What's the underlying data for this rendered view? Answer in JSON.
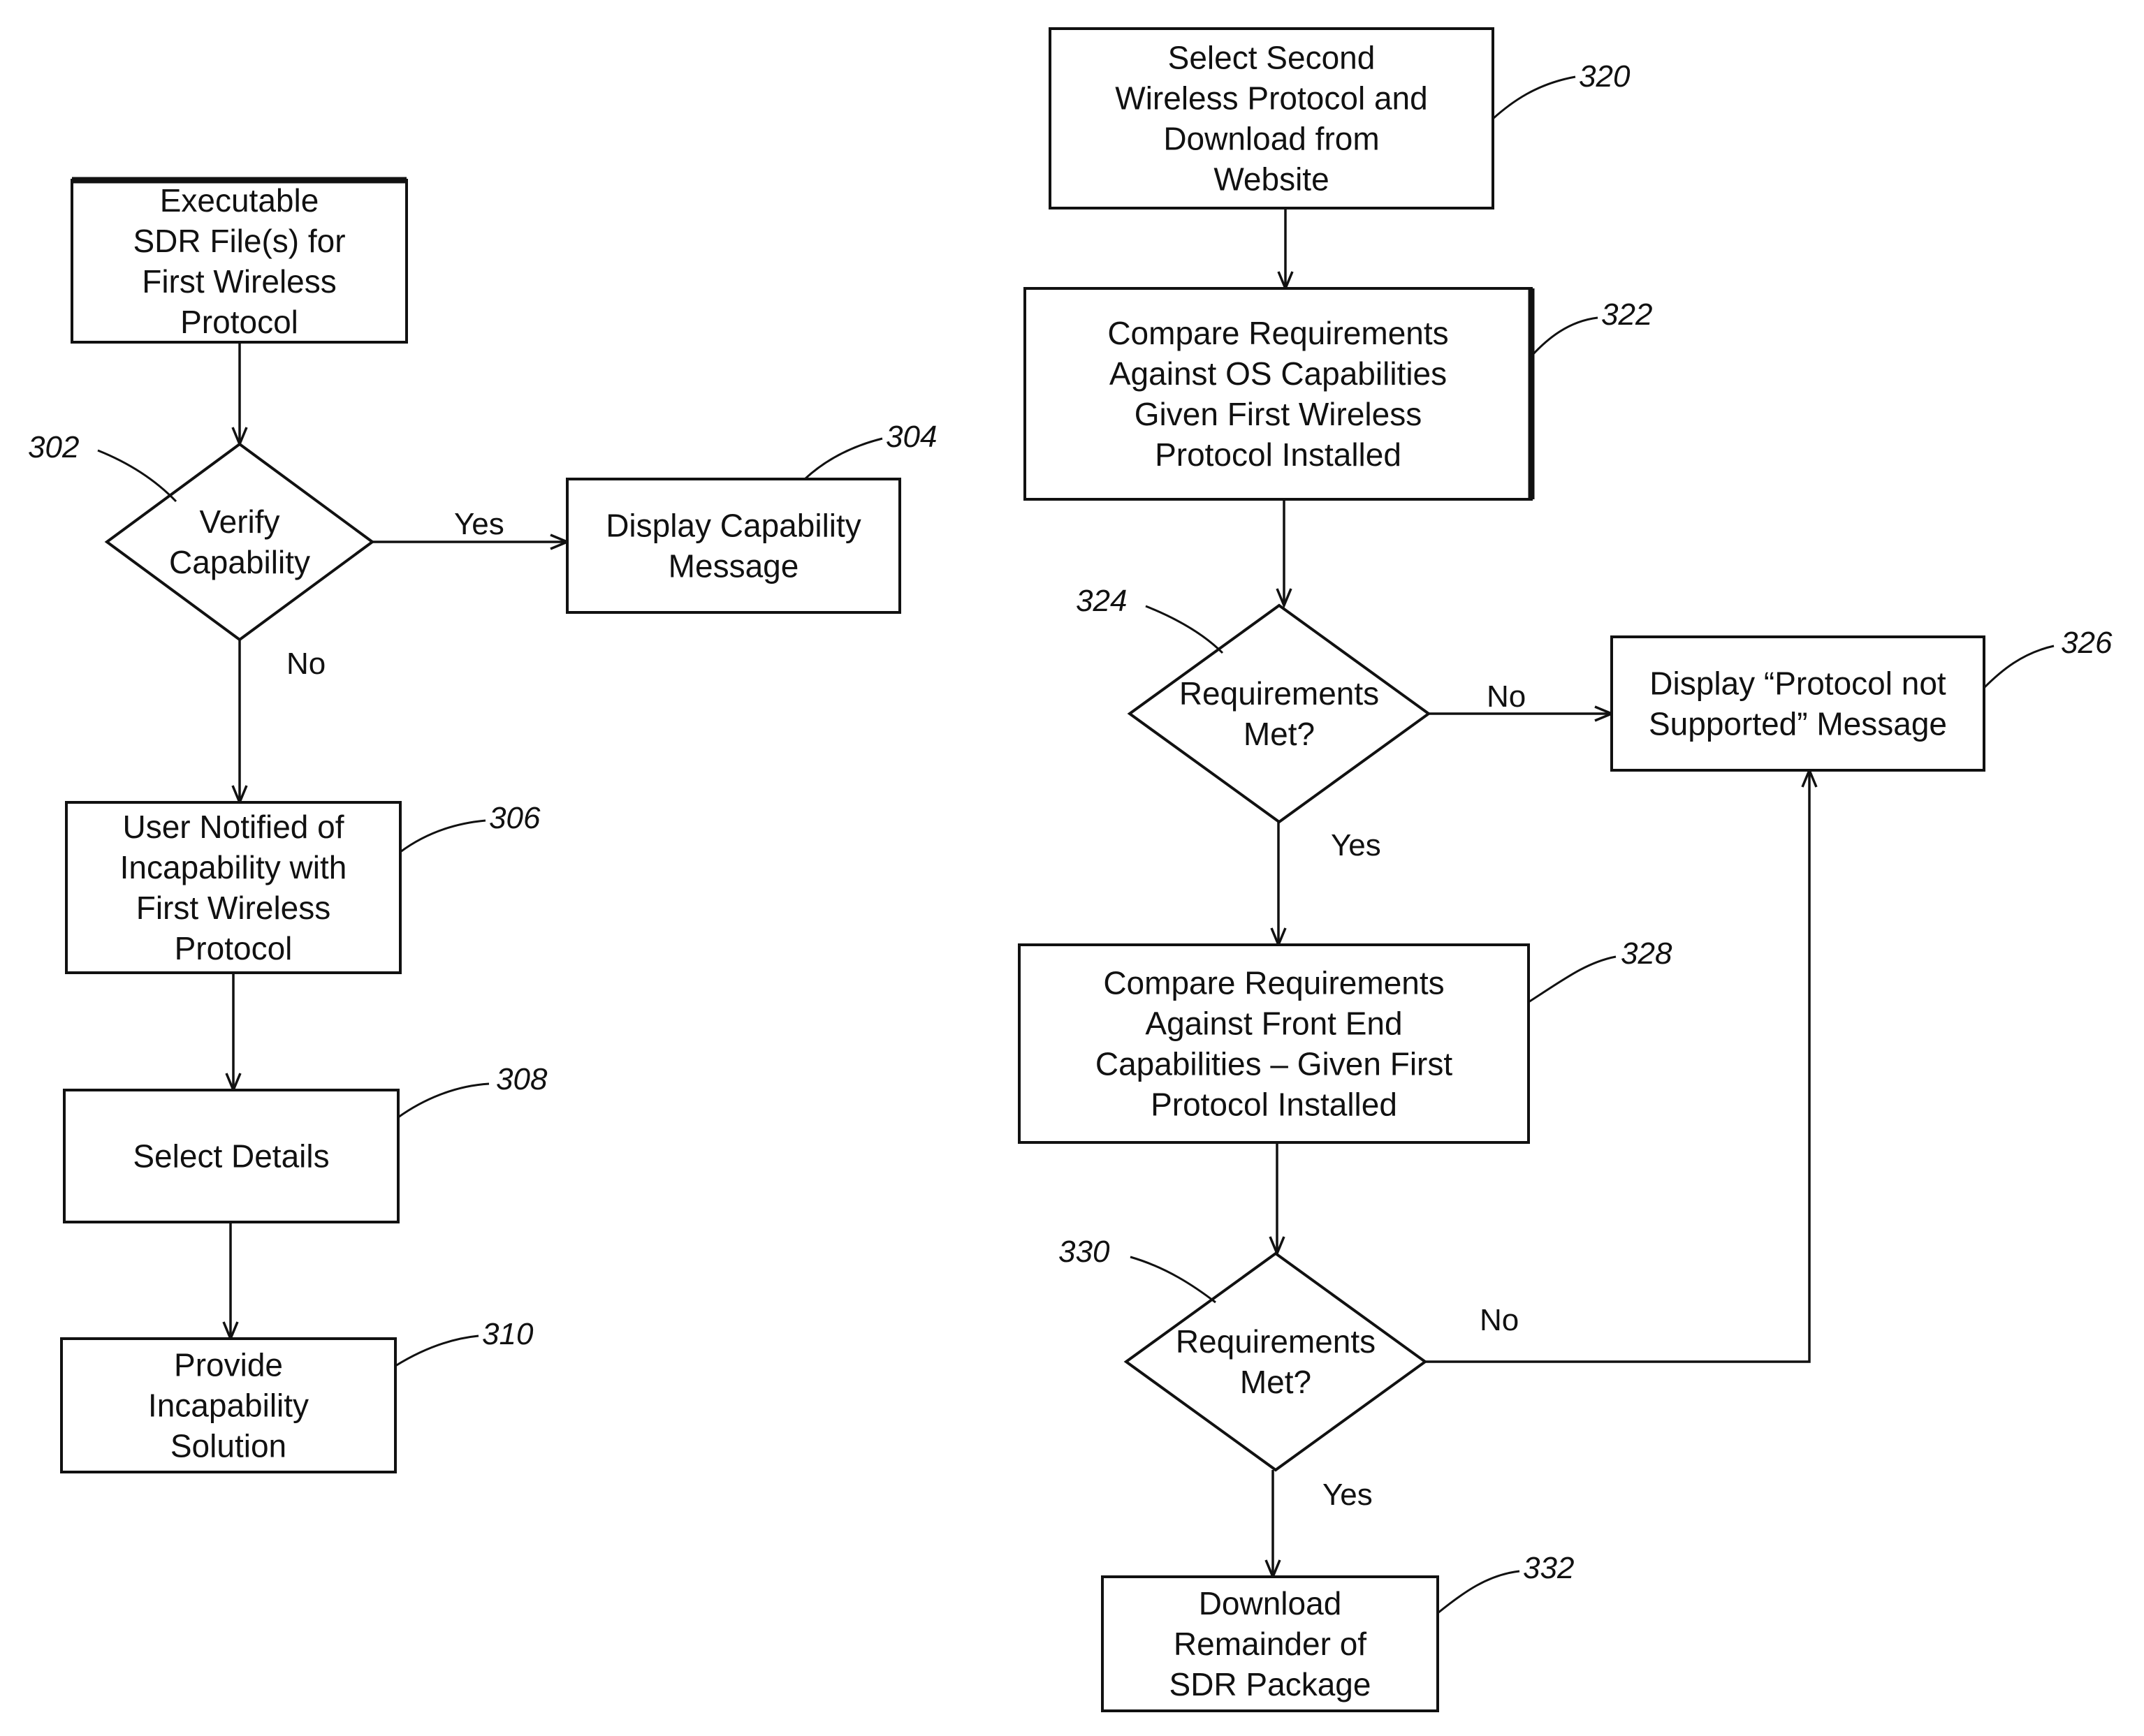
{
  "diagram": {
    "nodes": [
      {
        "id": "exec",
        "shape": "box",
        "lines": [
          "Executable",
          "SDR File(s) for",
          "First Wireless",
          "Protocol"
        ],
        "ref": ""
      },
      {
        "id": "302",
        "shape": "diamond",
        "lines": [
          "Verify",
          "Capability"
        ],
        "ref": "302"
      },
      {
        "id": "304",
        "shape": "box",
        "lines": [
          "Display Capability",
          "Message"
        ],
        "ref": "304"
      },
      {
        "id": "306",
        "shape": "box",
        "lines": [
          "User Notified of",
          "Incapability with",
          "First Wireless",
          "Protocol"
        ],
        "ref": "306"
      },
      {
        "id": "308",
        "shape": "box",
        "lines": [
          "Select Details"
        ],
        "ref": "308"
      },
      {
        "id": "310",
        "shape": "box",
        "lines": [
          "Provide",
          "Incapability",
          "Solution"
        ],
        "ref": "310"
      },
      {
        "id": "320",
        "shape": "box",
        "lines": [
          "Select Second",
          "Wireless Protocol and",
          "Download from",
          "Website"
        ],
        "ref": "320"
      },
      {
        "id": "322",
        "shape": "box",
        "lines": [
          "Compare Requirements",
          "Against OS Capabilities",
          "Given First Wireless",
          "Protocol Installed"
        ],
        "ref": "322"
      },
      {
        "id": "324",
        "shape": "diamond",
        "lines": [
          "Requirements",
          "Met?"
        ],
        "ref": "324"
      },
      {
        "id": "326",
        "shape": "box",
        "lines": [
          "Display “Protocol not",
          "Supported” Message"
        ],
        "ref": "326"
      },
      {
        "id": "328",
        "shape": "box",
        "lines": [
          "Compare Requirements",
          "Against Front End",
          "Capabilities – Given First",
          "Protocol Installed"
        ],
        "ref": "328"
      },
      {
        "id": "330",
        "shape": "diamond",
        "lines": [
          "Requirements",
          "Met?"
        ],
        "ref": "330"
      },
      {
        "id": "332",
        "shape": "box",
        "lines": [
          "Download",
          "Remainder of",
          "SDR Package"
        ],
        "ref": "332"
      }
    ],
    "edges": [
      {
        "from": "exec",
        "to": "302",
        "label": ""
      },
      {
        "from": "302",
        "to": "304",
        "label": "Yes"
      },
      {
        "from": "302",
        "to": "306",
        "label": "No"
      },
      {
        "from": "306",
        "to": "308",
        "label": ""
      },
      {
        "from": "308",
        "to": "310",
        "label": ""
      },
      {
        "from": "320",
        "to": "322",
        "label": ""
      },
      {
        "from": "322",
        "to": "324",
        "label": ""
      },
      {
        "from": "324",
        "to": "326",
        "label": "No"
      },
      {
        "from": "324",
        "to": "328",
        "label": "Yes"
      },
      {
        "from": "328",
        "to": "330",
        "label": ""
      },
      {
        "from": "330",
        "to": "326",
        "label": "No"
      },
      {
        "from": "330",
        "to": "332",
        "label": "Yes"
      }
    ]
  }
}
